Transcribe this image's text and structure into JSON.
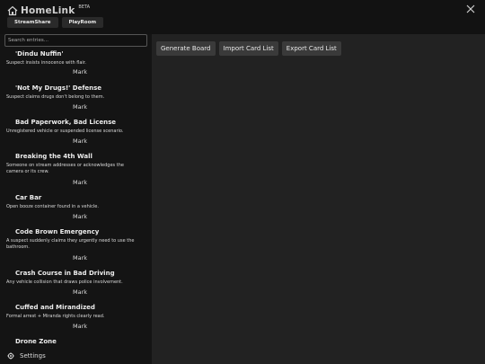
{
  "app": {
    "name": "HomeLink",
    "badge": "BETA"
  },
  "tabs": [
    {
      "label": "StreamShare"
    },
    {
      "label": "PlayRoom"
    }
  ],
  "search": {
    "placeholder": "Search entries..."
  },
  "cards": [
    {
      "title": "'Dindu Nuffin'",
      "description": "Suspect insists innocence with flair.",
      "mark_label": "Mark"
    },
    {
      "title": "'Not My Drugs!' Defense",
      "description": "Suspect claims drugs don't belong to them.",
      "mark_label": "Mark"
    },
    {
      "title": "Bad Paperwork, Bad License",
      "description": "Unregistered vehicle or suspended license scenario.",
      "mark_label": "Mark"
    },
    {
      "title": "Breaking the 4th Wall",
      "description": "Someone on stream addresses or acknowledges the camera or its crew.",
      "mark_label": "Mark"
    },
    {
      "title": "Car Bar",
      "description": "Open booze container found in a vehicle.",
      "mark_label": "Mark"
    },
    {
      "title": "Code Brown Emergency",
      "description": "A suspect suddenly claims they urgently need to use the bathroom.",
      "mark_label": "Mark"
    },
    {
      "title": "Crash Course in Bad Driving",
      "description": "Any vehicle collision that draws police involvement.",
      "mark_label": "Mark"
    },
    {
      "title": "Cuffed and Mirandized",
      "description": "Formal arrest + Miranda rights clearly read.",
      "mark_label": "Mark"
    },
    {
      "title": "Drone Zone",
      "description": "",
      "mark_label": ""
    }
  ],
  "settings": {
    "label": "Settings",
    "icon": "gear-icon"
  },
  "toolbar": {
    "generate_label": "Generate Board",
    "import_label": "Import Card List",
    "export_label": "Export Card List"
  },
  "icons": {
    "logo": "home-icon",
    "close": "close-icon"
  }
}
